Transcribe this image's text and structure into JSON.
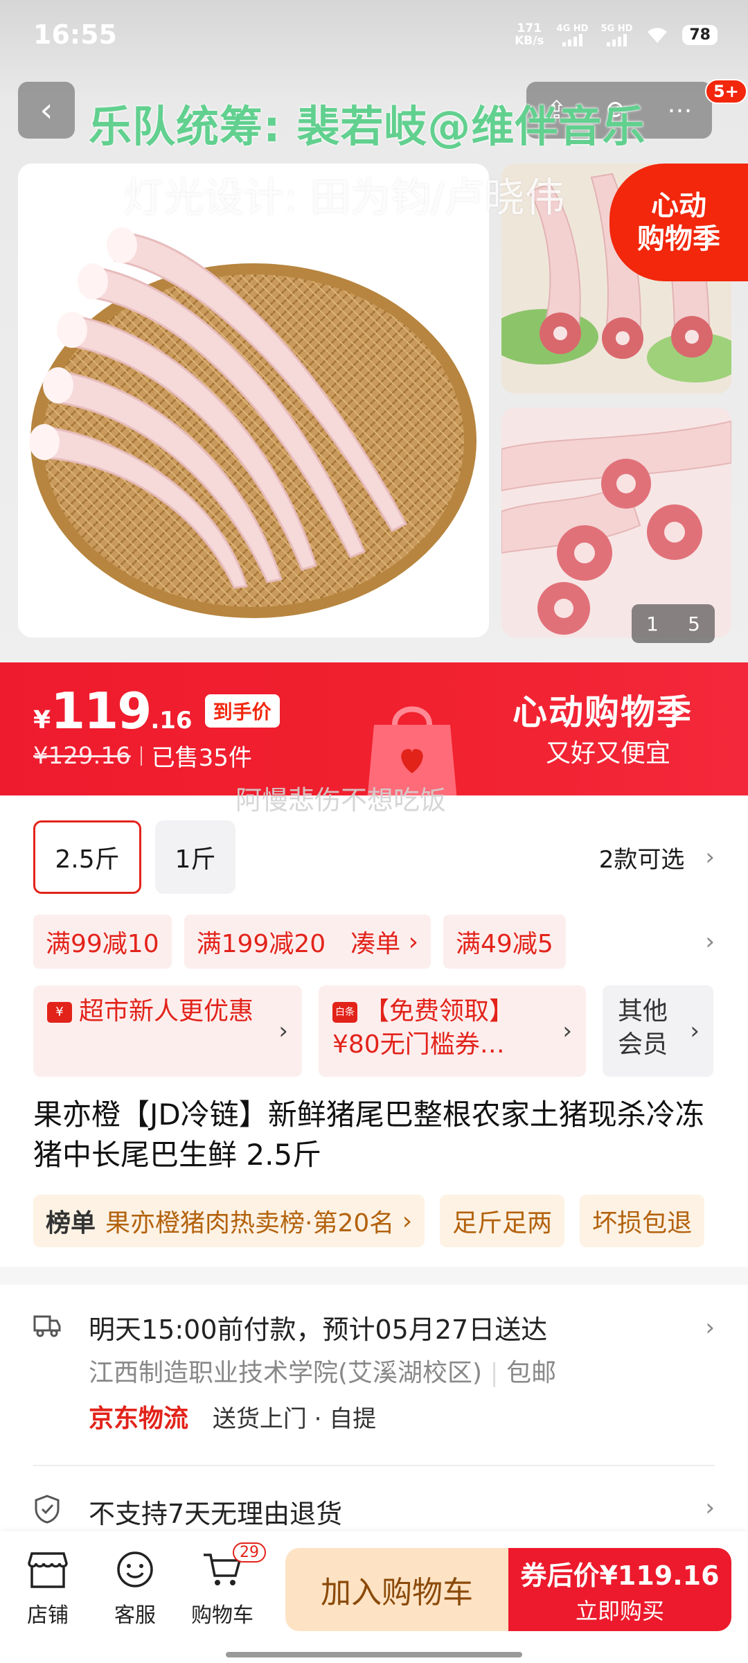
{
  "status_bar": {
    "time": "16:55",
    "net_speed_value": "171",
    "net_speed_unit": "KB/s",
    "net1": "4G HD",
    "net2": "5G HD",
    "battery": "78"
  },
  "header": {
    "back_icon": "chevron-left-icon",
    "badge": "5+"
  },
  "overlays": {
    "line1": "乐队统筹: 裴若岐@维伴音乐",
    "line2": "灯光设计: 田为钧/卢晓伟",
    "line3": "阿慢悲伤不想吃饭"
  },
  "gallery": {
    "stamp_line1": "心动",
    "stamp_line2": "购物季",
    "page_current": "1",
    "page_total": "5"
  },
  "price": {
    "yen": "¥",
    "integer": "119",
    "decimal": ".16",
    "tag": "到手价",
    "original": "¥129.16",
    "sold": "已售35件"
  },
  "banner": {
    "title": "心动购物季",
    "subtitle": "又好又便宜"
  },
  "specs": {
    "options": [
      "2.5斤",
      "1斤"
    ],
    "count_label": "2款可选"
  },
  "coupons": {
    "c1": "满99减10",
    "c2": "满199减20",
    "c2_join": "凑单",
    "c3": "满49减5"
  },
  "benefits": {
    "b1_icon": "¥",
    "b1_text": "超市新人更优惠",
    "b2_icon": "白条",
    "b2_line1": "【免费领取】",
    "b2_line2": "¥80无门槛券…",
    "b3_text": "其他会员"
  },
  "product": {
    "title": "果亦橙【JD冷链】新鲜猪尾巴整根农家土猪现杀冷冻猪中长尾巴生鲜 2.5斤"
  },
  "tags": {
    "rank_label": "榜单",
    "rank_text": "果亦橙猪肉热卖榜·第20名",
    "t2": "足斤足两",
    "t3": "坏损包退"
  },
  "delivery": {
    "line1": "明天15:00前付款，预计05月27日送达",
    "address": "江西制造职业技术学院(艾溪湖校区)",
    "shipping": "包邮",
    "carrier": "京东物流",
    "methods": "送货上门 · 自提"
  },
  "return_policy": "不支持7天无理由退货",
  "bottom_bar": {
    "store": "店铺",
    "service": "客服",
    "cart": "购物车",
    "cart_count": "29",
    "add_to_cart": "加入购物车",
    "buy_line1_prefix": "券后价",
    "buy_price": "¥119.16",
    "buy_line2": "立即购买"
  },
  "colors": {
    "brand_red": "#e2231a",
    "banner_red": "#f1202e",
    "coupon_bg": "#fdeeee",
    "cart_btn_bg": "#fde3c4"
  }
}
